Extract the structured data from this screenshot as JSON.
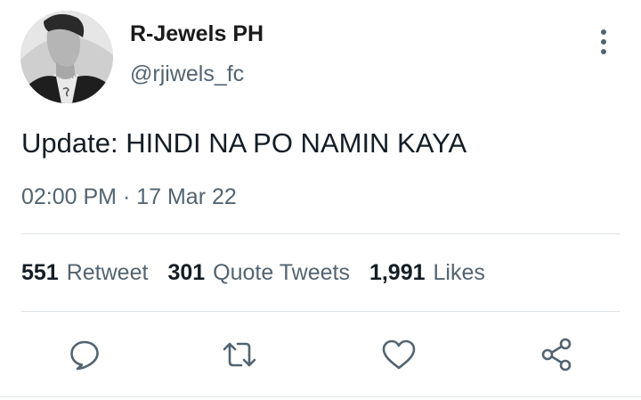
{
  "user": {
    "display_name": "R-Jewels PH",
    "handle": "@rjiwels_fc",
    "avatar_icon": "profile-photo"
  },
  "tweet": {
    "text": "Update: HINDI NA PO NAMIN KAYA",
    "timestamp": "02:00 PM · 17 Mar 22"
  },
  "stats": [
    {
      "count": "551",
      "label": "Retweet"
    },
    {
      "count": "301",
      "label": "Quote Tweets"
    },
    {
      "count": "1,991",
      "label": "Likes"
    }
  ],
  "actions": [
    {
      "icon": "reply-icon"
    },
    {
      "icon": "retweet-icon"
    },
    {
      "icon": "like-icon"
    },
    {
      "icon": "share-icon"
    }
  ],
  "colors": {
    "text": "#141d26",
    "secondary": "#536471",
    "divider": "#dde3e8"
  }
}
